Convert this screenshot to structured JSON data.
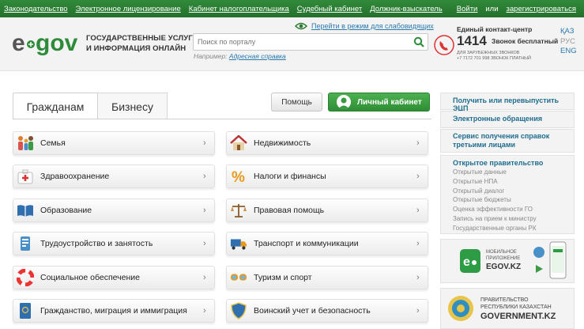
{
  "topbar": {
    "links": [
      "Законодательство",
      "Электронное лицензирование",
      "Кабинет налогоплательщика",
      "Судебный кабинет",
      "Должник-взыскатель"
    ],
    "login": "Войти",
    "or": "или",
    "register": "зарегистрироваться"
  },
  "header": {
    "logo_text": "egov",
    "title_line1": "ГОСУДАРСТВЕННЫЕ УСЛУГИ",
    "title_line2": "И ИНФОРМАЦИЯ ОНЛАЙН",
    "vision_link": "Перейти в режим для слабовидящих",
    "search_placeholder": "Поиск по порталу",
    "example_label": "Например:",
    "example_link": "Адресная справка",
    "contact_title": "Единый контакт-центр",
    "contact_number": "1414",
    "contact_free": "Звонок бесплатный",
    "contact_sub1": "для зарубежных звонков",
    "contact_sub2": "+7 7172 701 998 звонок платный",
    "langs": [
      "ҚАЗ",
      "РУС",
      "ENG"
    ]
  },
  "tabs": [
    "Гражданам",
    "Бизнесу"
  ],
  "buttons": {
    "help": "Помощь",
    "cabinet": "Личный кабинет"
  },
  "categories_left": [
    {
      "label": "Семья",
      "icon": "family-icon"
    },
    {
      "label": "Здравоохранение",
      "icon": "medkit-icon"
    },
    {
      "label": "Образование",
      "icon": "book-icon"
    },
    {
      "label": "Трудоустройство и занятость",
      "icon": "work-icon"
    },
    {
      "label": "Социальное обеспечение",
      "icon": "lifebuoy-icon"
    },
    {
      "label": "Гражданство, миграция и иммиграция",
      "icon": "passport-icon"
    }
  ],
  "categories_right": [
    {
      "label": "Недвижимость",
      "icon": "house-icon"
    },
    {
      "label": "Налоги и финансы",
      "icon": "percent-icon"
    },
    {
      "label": "Правовая помощь",
      "icon": "scales-icon"
    },
    {
      "label": "Транспорт и коммуникации",
      "icon": "truck-icon"
    },
    {
      "label": "Туризм и спорт",
      "icon": "goggles-icon"
    },
    {
      "label": "Воинский учет и безопасность",
      "icon": "shield-icon"
    }
  ],
  "sidebar": {
    "links": [
      "Получить или перевыпустить ЭЦП",
      "Электронные обращения",
      "Сервис получения справок третьими лицами"
    ],
    "open_gov_title": "Открытое правительство",
    "open_gov_items": [
      "Открытые данные",
      "Открытые НПА",
      "Открытый диалог",
      "Открытые бюджеты",
      "Оценка эффективности ГО",
      "Запись на прием к министру",
      "Государственные органы РК"
    ],
    "app_banner_line1": "МОБИЛЬНОЕ",
    "app_banner_line2": "ПРИЛОЖЕНИЕ",
    "app_banner_name": "EGOV.KZ",
    "gov_banner_line1": "ПРАВИТЕЛЬСТВО",
    "gov_banner_line2": "РЕСПУБЛИКИ КАЗАХСТАН",
    "gov_banner_name": "GOVERNMENT.KZ"
  },
  "colors": {
    "brand_green": "#2e8b3a",
    "link_blue": "#1f6d8f",
    "accent_red": "#d33"
  }
}
